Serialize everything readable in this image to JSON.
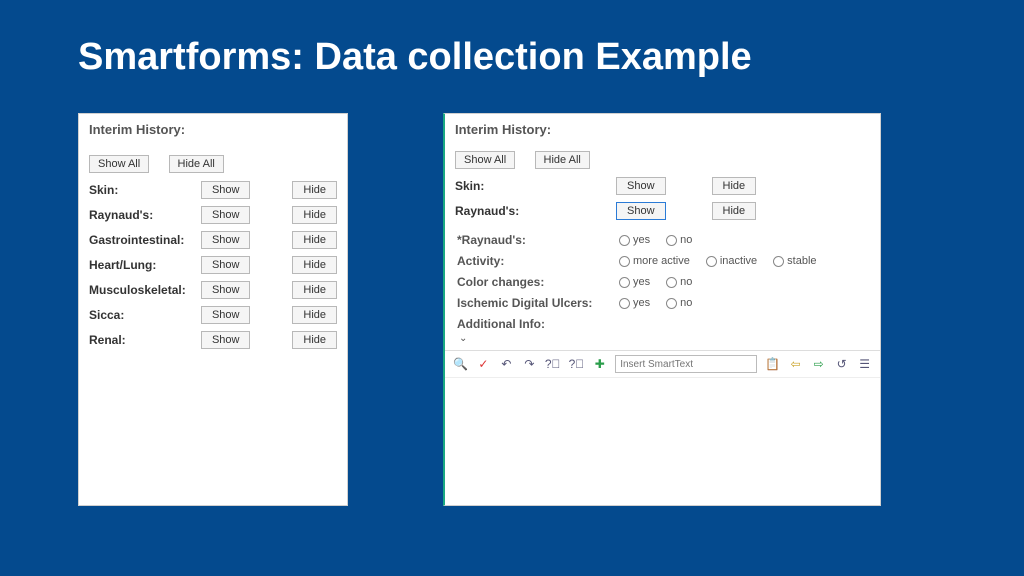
{
  "slide": {
    "title": "Smartforms: Data collection Example"
  },
  "left": {
    "heading": "Interim History:",
    "show_all": "Show All",
    "hide_all": "Hide All",
    "show": "Show",
    "hide": "Hide",
    "rows": [
      {
        "label": "Skin:"
      },
      {
        "label": "Raynaud's:"
      },
      {
        "label": "Gastrointestinal:"
      },
      {
        "label": "Heart/Lung:"
      },
      {
        "label": "Musculoskeletal:"
      },
      {
        "label": "Sicca:"
      },
      {
        "label": "Renal:"
      }
    ]
  },
  "right": {
    "heading": "Interim History:",
    "show_all": "Show All",
    "hide_all": "Hide All",
    "show": "Show",
    "hide": "Hide",
    "rows": [
      {
        "label": "Skin:"
      },
      {
        "label": "Raynaud's:"
      }
    ],
    "detail": {
      "q1": {
        "label": "*Raynaud's:",
        "o1": "yes",
        "o2": "no"
      },
      "q2": {
        "label": "Activity:",
        "o1": "more active",
        "o2": "inactive",
        "o3": "stable"
      },
      "q3": {
        "label": "Color changes:",
        "o1": "yes",
        "o2": "no"
      },
      "q4": {
        "label": "Ischemic Digital Ulcers:",
        "o1": "yes",
        "o2": "no"
      },
      "additional": "Additional Info:"
    },
    "toolbar": {
      "placeholder": "Insert SmartText"
    }
  }
}
